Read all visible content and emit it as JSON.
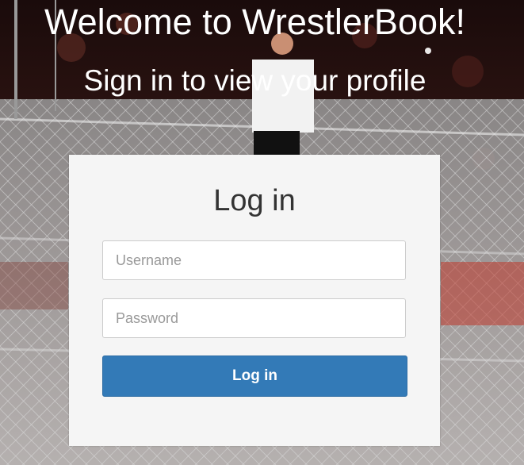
{
  "header": {
    "title": "Welcome to WrestlerBook!",
    "subtitle": "Sign in to view your profile"
  },
  "login_card": {
    "heading": "Log in",
    "username": {
      "placeholder": "Username",
      "value": ""
    },
    "password": {
      "placeholder": "Password",
      "value": ""
    },
    "submit_label": "Log in"
  },
  "colors": {
    "card_background": "#f5f5f5",
    "button_primary": "#337ab7",
    "button_text": "#ffffff",
    "heading_text": "#333333"
  }
}
